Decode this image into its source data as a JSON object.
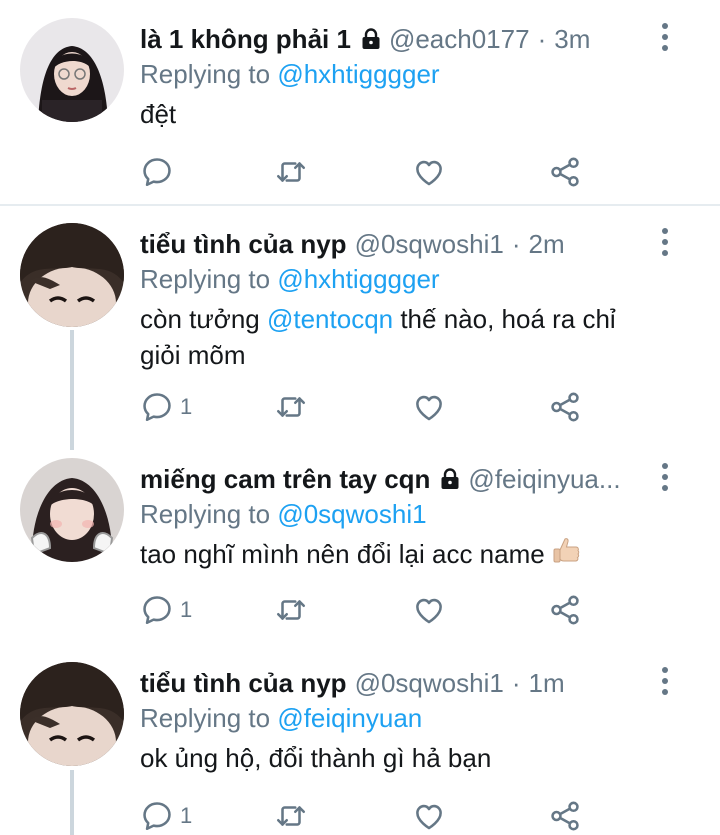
{
  "tweets": [
    {
      "display_name": "là 1 không phải 1",
      "locked": true,
      "handle": "@each0177",
      "separator": "·",
      "time": "3m",
      "replying_prefix": "Replying to",
      "replying_to": "@hxhtigggger",
      "text_parts": [
        "đệt"
      ],
      "reply_count": "",
      "retweet_count": "",
      "like_count": ""
    },
    {
      "display_name": "tiểu tình của nyp",
      "locked": false,
      "handle": "@0sqwoshi1",
      "separator": "·",
      "time": "2m",
      "replying_prefix": "Replying to",
      "replying_to": "@hxhtigggger",
      "text_before": "còn tưởng ",
      "text_mention": "@tentocqn",
      "text_after": " thế nào, hoá ra chỉ giỏi mõm",
      "reply_count": "1",
      "retweet_count": "",
      "like_count": ""
    },
    {
      "display_name": "miếng cam trên tay cqn",
      "locked": true,
      "handle": "@feiqinyua...",
      "separator": "",
      "time": "",
      "replying_prefix": "Replying to",
      "replying_to": "@0sqwoshi1",
      "text": "tao nghĩ mình nên đổi lại acc name",
      "emoji": "thumbs-up-icon",
      "reply_count": "1",
      "retweet_count": "",
      "like_count": ""
    },
    {
      "display_name": "tiểu tình của nyp",
      "locked": false,
      "handle": "@0sqwoshi1",
      "separator": "·",
      "time": "1m",
      "replying_prefix": "Replying to",
      "replying_to": "@feiqinyuan",
      "text": "ok ủng hộ, đổi thành gì hả bạn",
      "reply_count": "1",
      "retweet_count": "",
      "like_count": ""
    }
  ],
  "icons": {
    "reply": "reply-icon",
    "retweet": "retweet-icon",
    "like": "heart-icon",
    "share": "share-icon",
    "more": "more-vertical-icon",
    "lock": "lock-icon"
  },
  "colors": {
    "accent": "#1da1f2",
    "secondary_text": "#657786",
    "primary_text": "#14171a",
    "divider": "#e6ecf0"
  }
}
